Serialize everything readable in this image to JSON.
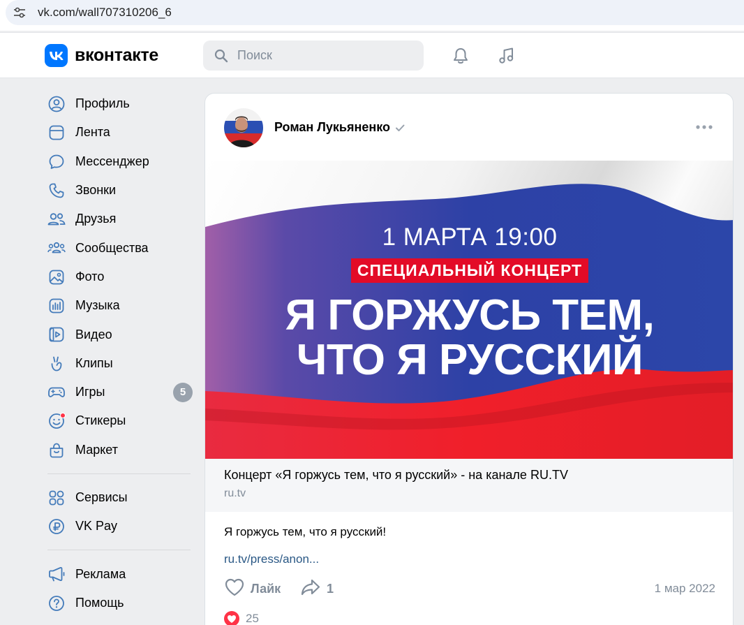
{
  "browser": {
    "url": "vk.com/wall707310206_6"
  },
  "header": {
    "logo_text": "вконтакте",
    "search_placeholder": "Поиск",
    "brand_color": "#0077ff"
  },
  "sidebar": {
    "items": [
      {
        "label": "Профиль",
        "icon": "profile-icon"
      },
      {
        "label": "Лента",
        "icon": "news-icon"
      },
      {
        "label": "Мессенджер",
        "icon": "message-icon"
      },
      {
        "label": "Звонки",
        "icon": "phone-icon"
      },
      {
        "label": "Друзья",
        "icon": "friends-icon"
      },
      {
        "label": "Сообщества",
        "icon": "communities-icon"
      },
      {
        "label": "Фото",
        "icon": "photo-icon"
      },
      {
        "label": "Музыка",
        "icon": "music-icon"
      },
      {
        "label": "Видео",
        "icon": "video-icon"
      },
      {
        "label": "Клипы",
        "icon": "clips-icon"
      },
      {
        "label": "Игры",
        "icon": "games-icon",
        "badge": "5"
      },
      {
        "label": "Стикеры",
        "icon": "stickers-icon"
      },
      {
        "label": "Маркет",
        "icon": "market-icon"
      }
    ],
    "items2": [
      {
        "label": "Сервисы",
        "icon": "services-icon"
      },
      {
        "label": "VK Pay",
        "icon": "vkpay-icon"
      }
    ],
    "items3": [
      {
        "label": "Реклама",
        "icon": "ads-icon"
      },
      {
        "label": "Помощь",
        "icon": "help-icon"
      }
    ]
  },
  "post": {
    "author": "Роман Лукьяненко",
    "banner": {
      "date": "1 МАРТА 19:00",
      "tag": "СПЕЦИАЛЬНЫЙ КОНЦЕРТ",
      "title_line1": "Я ГОРЖУСЬ ТЕМ,",
      "title_line2": "ЧТО Я РУССКИЙ"
    },
    "link_title": "Концерт «Я горжусь тем, что я русский» - на канале RU.TV",
    "link_domain": "ru.tv",
    "text": "Я горжусь тем, что я русский!",
    "text_link": "ru.tv/press/anon...",
    "like_label": "Лайк",
    "share_count": "1",
    "date": "1 мар 2022",
    "likes_count": "25"
  }
}
